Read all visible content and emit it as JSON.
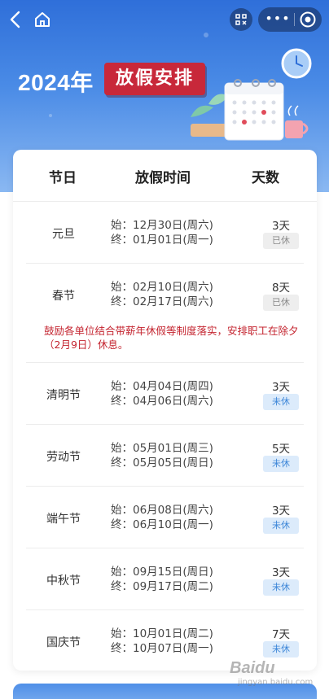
{
  "title": {
    "year": "2024年",
    "tag": "放假安排"
  },
  "nav": {
    "capsule_more": "•••"
  },
  "table": {
    "headers": [
      "节日",
      "放假时间",
      "天数"
    ],
    "rows": [
      {
        "name": "元旦",
        "start": "始：12月30日(周六)",
        "end": "终：01月01日(周一)",
        "days": "3天",
        "status": "已休",
        "state": "done"
      },
      {
        "name": "春节",
        "start": "始：02月10日(周六)",
        "end": "终：02月17日(周六)",
        "days": "8天",
        "status": "已休",
        "state": "done"
      },
      {
        "name": "清明节",
        "start": "始：04月04日(周四)",
        "end": "终：04月06日(周六)",
        "days": "3天",
        "status": "未休",
        "state": "todo"
      },
      {
        "name": "劳动节",
        "start": "始：05月01日(周三)",
        "end": "终：05月05日(周日)",
        "days": "5天",
        "status": "未休",
        "state": "todo"
      },
      {
        "name": "端午节",
        "start": "始：06月08日(周六)",
        "end": "终：06月10日(周一)",
        "days": "3天",
        "status": "未休",
        "state": "todo"
      },
      {
        "name": "中秋节",
        "start": "始：09月15日(周日)",
        "end": "终：09月17日(周二)",
        "days": "3天",
        "status": "未休",
        "state": "todo"
      },
      {
        "name": "国庆节",
        "start": "始：10月01日(周二)",
        "end": "终：10月07日(周一)",
        "days": "7天",
        "status": "未休",
        "state": "todo"
      }
    ],
    "spring_note": "鼓励各单位结合带薪年休假等制度落实，安排职工在除夕（2月9日）休息。"
  },
  "watermark": {
    "brand": "Baidu",
    "site": "jingyan.baidu.com"
  },
  "colors": {
    "header_blue": "#2f6fd9",
    "tag_red": "#c8283a",
    "note_red": "#c4242f",
    "done_gray": "#8a8a8a",
    "todo_blue": "#3c86d8"
  }
}
